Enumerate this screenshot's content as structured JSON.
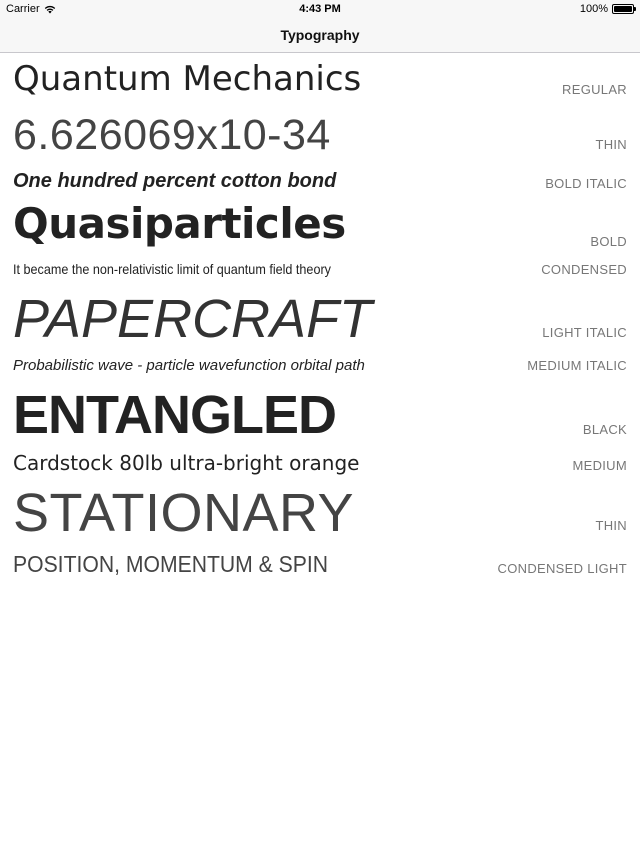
{
  "status_bar": {
    "carrier": "Carrier",
    "time": "4:43 PM",
    "battery_percent": "100%",
    "battery_level": 1.0
  },
  "nav": {
    "title": "Typography"
  },
  "rows": [
    {
      "sample": "Quantum Mechanics",
      "weight": "REGULAR"
    },
    {
      "sample": "6.626069x10-34",
      "weight": "THIN"
    },
    {
      "sample": "One hundred percent cotton bond",
      "weight": "BOLD ITALIC"
    },
    {
      "sample": "Quasiparticles",
      "weight": "BOLD"
    },
    {
      "sample": "It became the non-relativistic limit of quantum field theory",
      "weight": "CONDENSED"
    },
    {
      "sample": "PAPERCRAFT",
      "weight": "LIGHT ITALIC"
    },
    {
      "sample": "Probabilistic wave - particle wavefunction orbital path",
      "weight": "MEDIUM ITALIC"
    },
    {
      "sample": "ENTANGLED",
      "weight": "BLACK"
    },
    {
      "sample": "Cardstock 80lb ultra-bright orange",
      "weight": "MEDIUM"
    },
    {
      "sample": "STATIONARY",
      "weight": "THIN"
    },
    {
      "sample": "POSITION, MOMENTUM & SPIN",
      "weight": "CONDENSED LIGHT"
    }
  ]
}
